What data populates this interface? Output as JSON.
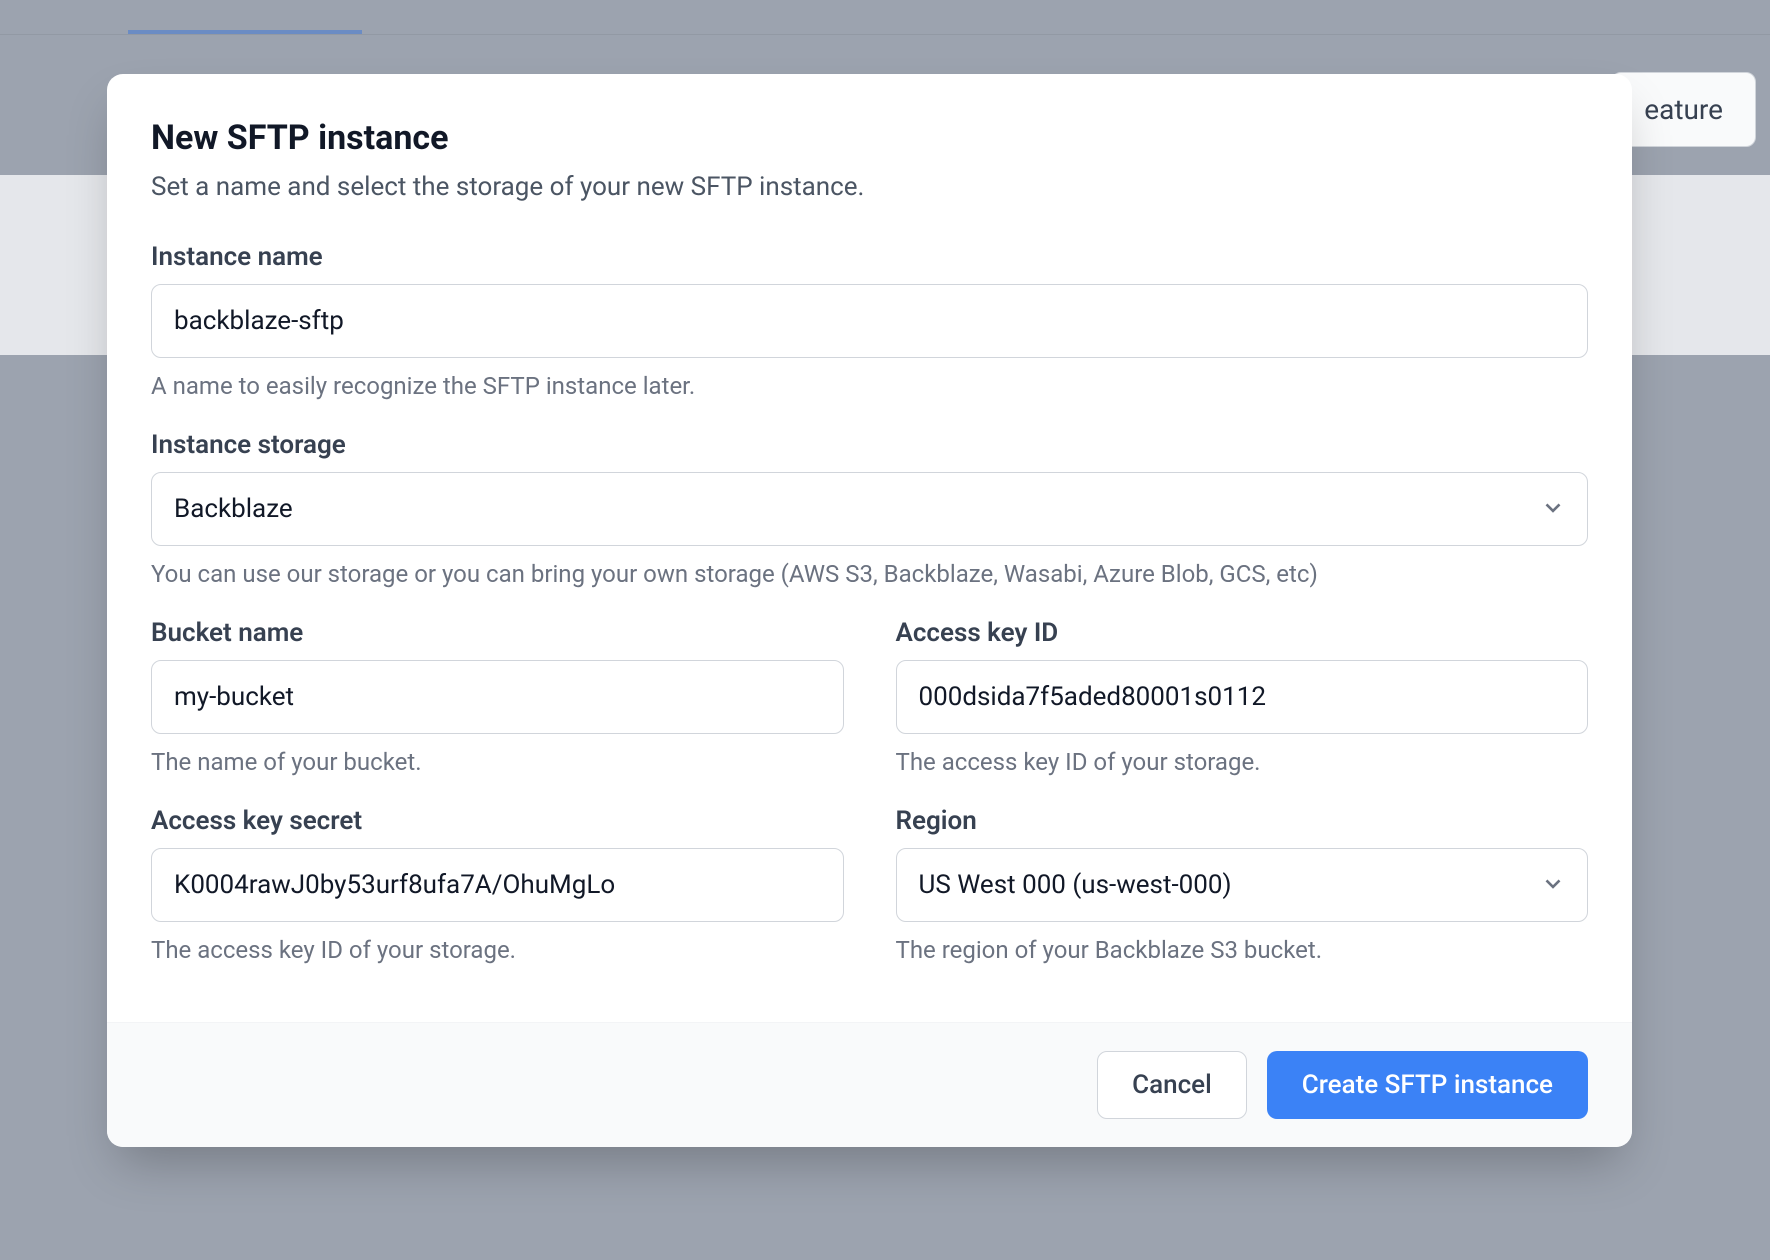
{
  "background": {
    "feature_button": "eature"
  },
  "modal": {
    "title": "New SFTP instance",
    "subtitle": "Set a name and select the storage of your new SFTP instance.",
    "fields": {
      "instance_name": {
        "label": "Instance name",
        "value": "backblaze-sftp",
        "help": "A name to easily recognize the SFTP instance later."
      },
      "instance_storage": {
        "label": "Instance storage",
        "value": "Backblaze",
        "help": "You can use our storage or you can bring your own storage (AWS S3, Backblaze, Wasabi, Azure Blob, GCS, etc)"
      },
      "bucket_name": {
        "label": "Bucket name",
        "value": "my-bucket",
        "help": "The name of your bucket."
      },
      "access_key_id": {
        "label": "Access key ID",
        "value": "000dsida7f5aded80001s0112",
        "help": "The access key ID of your storage."
      },
      "access_key_secret": {
        "label": "Access key secret",
        "value": "K0004rawJ0by53urf8ufa7A/OhuMgLo",
        "help": "The access key ID of your storage."
      },
      "region": {
        "label": "Region",
        "value": "US West 000 (us-west-000)",
        "help": "The region of your Backblaze S3 bucket."
      }
    },
    "buttons": {
      "cancel": "Cancel",
      "submit": "Create SFTP instance"
    }
  }
}
